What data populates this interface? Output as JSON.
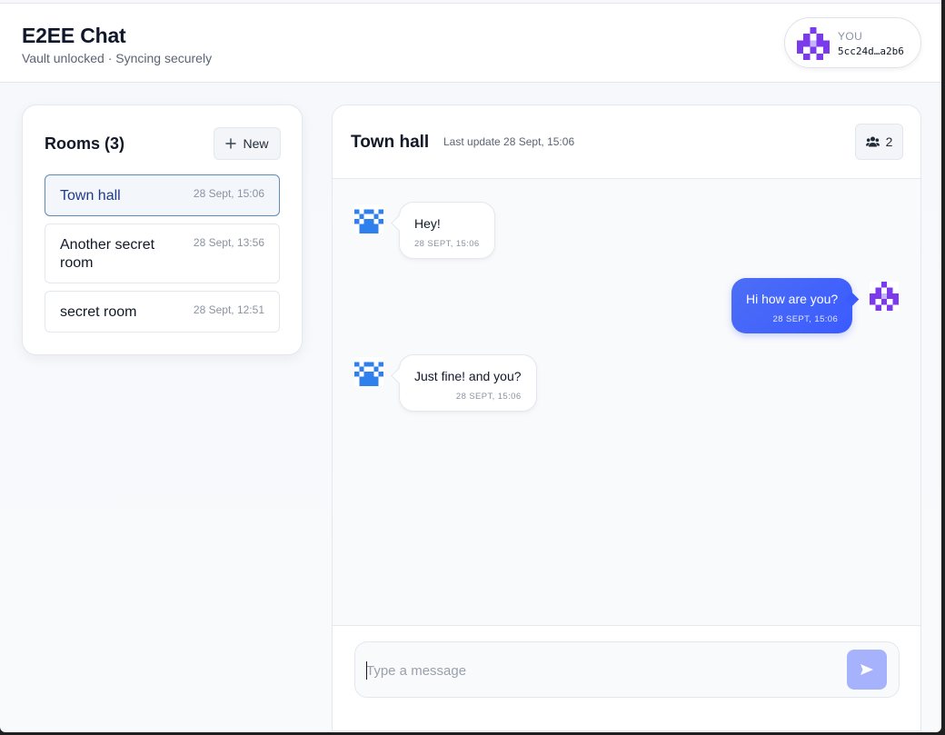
{
  "header": {
    "title": "E2EE Chat",
    "subtitle": "Vault unlocked · Syncing securely"
  },
  "identity": {
    "label": "YOU",
    "id": "5cc24d…a2b6",
    "avatar_icon": "identicon-purple-icon",
    "avatar_color": "#7c3aed"
  },
  "rooms": {
    "title": "Rooms (3)",
    "new_label": "New",
    "items": [
      {
        "name": "Town hall",
        "time": "28 Sept, 15:06",
        "active": true
      },
      {
        "name": "Another secret room",
        "time": "28 Sept, 13:56",
        "active": false
      },
      {
        "name": "secret room",
        "time": "28 Sept, 12:51",
        "active": false
      }
    ]
  },
  "chat": {
    "title": "Town hall",
    "updated": "Last update 28 Sept, 15:06",
    "members_count": "2",
    "messages": [
      {
        "text": "Hey!",
        "time": "28 SEPT, 15:06",
        "direction": "in",
        "avatar_icon": "identicon-blue-icon"
      },
      {
        "text": "Hi how are you?",
        "time": "28 SEPT, 15:06",
        "direction": "out",
        "avatar_icon": "identicon-purple-icon"
      },
      {
        "text": "Just fine! and you?",
        "time": "28 SEPT, 15:06",
        "direction": "in",
        "avatar_icon": "identicon-blue-icon"
      }
    ]
  },
  "composer": {
    "placeholder": "Type a message",
    "value": ""
  },
  "colors": {
    "accent": "#3b5bff",
    "peer_avatar": "#2f80ed",
    "self_avatar": "#7c3aed",
    "send_disabled": "#a6b2fb"
  }
}
